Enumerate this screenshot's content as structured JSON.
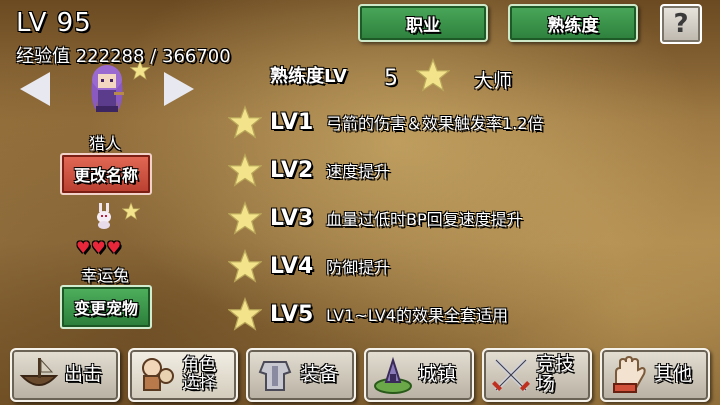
{
  "header": {
    "level": "LV 95",
    "exp_label": "经验值",
    "exp_current": "222288",
    "exp_separator": "/",
    "exp_max": "366700"
  },
  "top_buttons": {
    "job": "职业",
    "proficiency": "熟练度",
    "help": "?"
  },
  "character": {
    "class_name": "猎人",
    "rename_button": "更改名称",
    "pet_name": "幸运兔",
    "change_pet_button": "变更宠物",
    "hearts": "♥♥♥"
  },
  "proficiency": {
    "label": "熟练度LV",
    "value": "5",
    "rank": "大师",
    "rows": [
      {
        "level": "LV1",
        "desc": "弓箭的伤害＆效果触发率1.2倍"
      },
      {
        "level": "LV2",
        "desc": "速度提升"
      },
      {
        "level": "LV3",
        "desc": "血量过低时BP回复速度提升"
      },
      {
        "level": "LV4",
        "desc": "防御提升"
      },
      {
        "level": "LV5",
        "desc": "LV1~LV4的效果全套适用"
      }
    ]
  },
  "nav": [
    {
      "label": "出击",
      "icon": "boat-icon"
    },
    {
      "label_line1": "角色",
      "label_line2": "选择",
      "icon": "character-select-icon"
    },
    {
      "label": "装备",
      "icon": "armor-icon"
    },
    {
      "label": "城镇",
      "icon": "town-icon"
    },
    {
      "label": "竞技场",
      "icon": "crossed-swords-icon"
    },
    {
      "label": "其他",
      "icon": "hand-icon"
    }
  ],
  "colors": {
    "star": "#f4e38a",
    "green_button": "#3a9a4a",
    "red_button": "#cc5040",
    "heart": "#e8283a"
  }
}
